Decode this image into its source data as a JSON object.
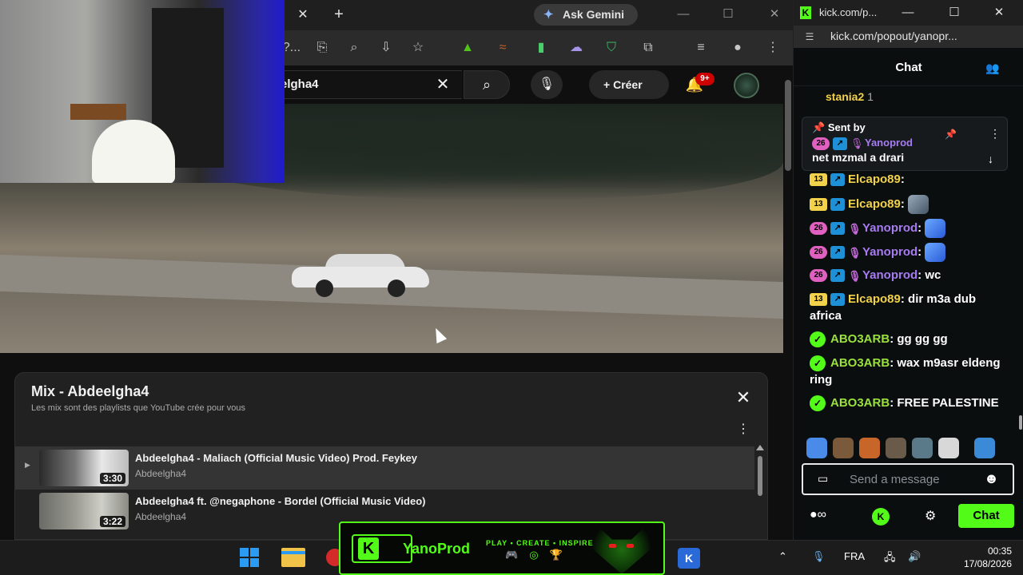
{
  "browser": {
    "gemini_label": "Ask Gemini",
    "omnibox_fragment": "?..."
  },
  "youtube": {
    "search_value": "elgha4",
    "create_label": "Créer",
    "notif_count": "9+"
  },
  "mix": {
    "title": "Mix - Abdeelgha4",
    "subtitle": "Les mix sont des playlists que YouTube crée pour vous",
    "items": [
      {
        "title": "Abdeelgha4 - Maliach (Official Music Video) Prod. Feykey",
        "channel": "Abdeelgha4",
        "duration": "3:30"
      },
      {
        "title": "Abdeelgha4 ft. @negaphone - Bordel (Official Music Video)",
        "channel": "Abdeelgha4",
        "duration": "3:22"
      }
    ]
  },
  "kick": {
    "tab_title": "kick.com/p...",
    "url": "kick.com/popout/yanopr...",
    "chat_title": "Chat",
    "top_user": {
      "name": "stania2",
      "count": "1"
    },
    "pinned": {
      "sent_by": "Sent by",
      "badge": "26",
      "user": "Yanoprod",
      "text": "net mzmal a drari"
    },
    "messages": [
      {
        "badge": "13",
        "user": "Elcapo89",
        "sep": ":",
        "text": ""
      },
      {
        "badge": "26",
        "user": "Yanoprod",
        "sep": ":",
        "text": ""
      },
      {
        "badge": "26",
        "user": "Yanoprod",
        "sep": ":",
        "text": ""
      },
      {
        "badge": "26",
        "user": "Yanoprod",
        "sep": ":",
        "text": "wc"
      },
      {
        "badge": "13",
        "user": "Elcapo89",
        "sep": ":",
        "text": "dir m3a dub africa"
      },
      {
        "user": "ABO3ARB",
        "sep": ":",
        "text": "gg gg gg"
      },
      {
        "user": "ABO3ARB",
        "sep": ":",
        "text": "wax m9asr eldeng ring"
      },
      {
        "user": "ABO3ARB",
        "sep": ":",
        "text": "FREE PALESTINE"
      }
    ],
    "input_placeholder": "Send a message",
    "chat_button": "Chat"
  },
  "banner": {
    "name": "YanoProd",
    "tagline": "PLAY • CREATE • INSPIRE",
    "k_letter": "K"
  },
  "taskbar": {
    "lang": "FRA",
    "time": "00:35",
    "date": "17/08/2026"
  },
  "colors": {
    "kick_green": "#53fc18",
    "yt_red": "#cc0000",
    "sub_yellow": "#f2d24a",
    "sub_pink": "#e060c0",
    "mod_purple": "#a67cf0"
  }
}
